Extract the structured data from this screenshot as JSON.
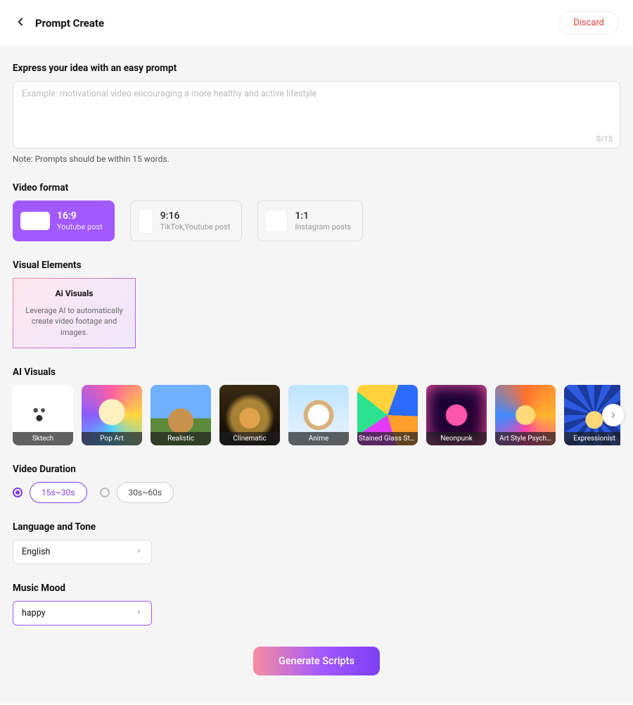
{
  "header": {
    "title": "Prompt  Create",
    "discard_label": "Discard"
  },
  "prompt": {
    "section_title": "Express your idea with an easy prompt",
    "placeholder": "Example: motivational video encouraging a more healthy and active lifestyle",
    "value": "",
    "char_count": "0/15",
    "note": "Note: Prompts should be within 15 words."
  },
  "video_format": {
    "section_title": "Video format",
    "options": [
      {
        "ratio": "16:9",
        "sub": "Youtube post",
        "selected": true
      },
      {
        "ratio": "9:16",
        "sub": "TikTok,Youtube post",
        "selected": false
      },
      {
        "ratio": "1:1",
        "sub": "Instagram posts",
        "selected": false
      }
    ]
  },
  "visual_elements": {
    "section_title": "Visual Elements",
    "card": {
      "title": "Ai Visuals",
      "desc": "Leverage AI to automatically create video footage and images."
    }
  },
  "ai_visuals": {
    "section_title": "AI Visuals",
    "styles": [
      {
        "label": "Sktech"
      },
      {
        "label": "Pop Art"
      },
      {
        "label": "Realistic"
      },
      {
        "label": "Clinematic"
      },
      {
        "label": "Anime"
      },
      {
        "label": "Stained Glass Style"
      },
      {
        "label": "Neonpunk"
      },
      {
        "label": "Art Style Psych…"
      },
      {
        "label": "Expressionist"
      }
    ]
  },
  "video_duration": {
    "section_title": "Video Duration",
    "options": [
      {
        "label": "15s~30s",
        "selected": true
      },
      {
        "label": "30s~60s",
        "selected": false
      }
    ]
  },
  "language": {
    "section_title": "Language and Tone",
    "value": "English"
  },
  "music": {
    "section_title": "Music Mood",
    "value": "happy"
  },
  "generate_label": "Generate Scripts"
}
